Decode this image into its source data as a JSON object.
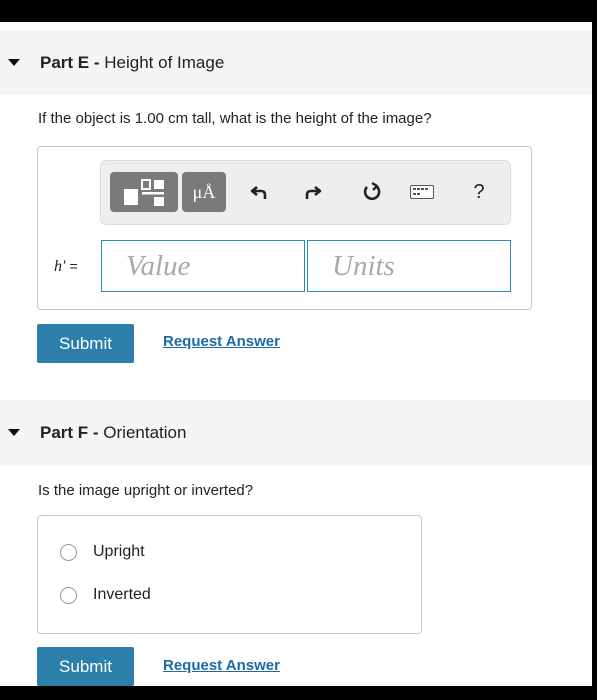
{
  "partE": {
    "label": "Part E -",
    "title": "Height of Image",
    "question": "If the object is 1.00 cm tall, what is the height of the image?",
    "toolbar": {
      "units_symbol": "μÅ",
      "help_symbol": "?",
      "icons": [
        "templates-icon",
        "units-icon",
        "undo-icon",
        "redo-icon",
        "reset-icon",
        "keyboard-icon",
        "help-icon"
      ]
    },
    "variable_label": "h′",
    "equals": "=",
    "value_placeholder": "Value",
    "units_placeholder": "Units",
    "submit_label": "Submit",
    "request_label": "Request Answer"
  },
  "partF": {
    "label": "Part F -",
    "title": "Orientation",
    "question": "Is the image upright or inverted?",
    "options": [
      "Upright",
      "Inverted"
    ],
    "submit_label": "Submit",
    "request_label": "Request Answer"
  },
  "colors": {
    "submit_bg": "#2b7fa8",
    "link": "#1a6aa8",
    "field_border": "#2a8fb0",
    "header_bg": "#f5f5f5"
  }
}
